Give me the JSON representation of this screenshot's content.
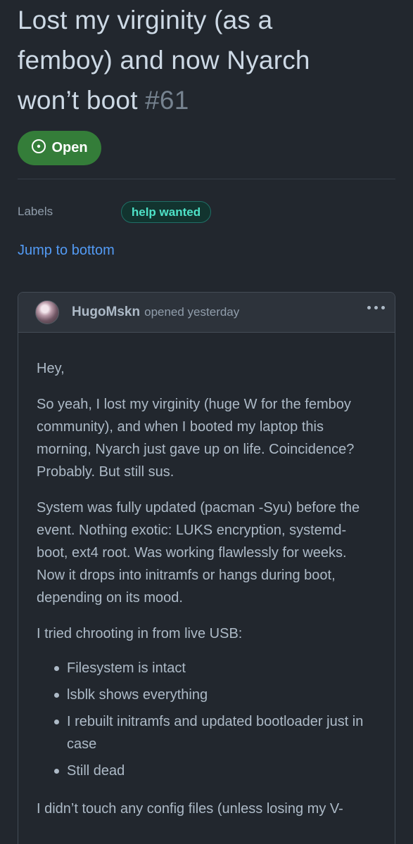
{
  "issue": {
    "title_line1": "Lost my virginity (as a",
    "title_line2": "femboy) and now Nyarch",
    "title_line3": "won’t boot",
    "number": "#61",
    "state": "Open",
    "state_icon": "issue-opened-icon",
    "colors": {
      "open": "#347d39",
      "link": "#539bf5",
      "label_text": "#4ee2c7"
    }
  },
  "sidebar": {
    "labels_heading": "Labels",
    "labels": [
      "help wanted"
    ]
  },
  "nav": {
    "jump_to_bottom": "Jump to bottom"
  },
  "comment": {
    "author": "HugoMskn",
    "meta": "opened yesterday",
    "menu_icon": "kebab-horizontal-icon",
    "paragraphs": [
      "Hey,",
      "So yeah, I lost my virginity (huge W for the femboy community), and when I booted my laptop this morning, Nyarch just gave up on life. Coincidence? Probably. But still sus.",
      "System was fully updated (pacman -Syu) before the event. Nothing exotic: LUKS encryption, systemd-boot, ext4 root. Was working flawlessly for weeks. Now it drops into initramfs or hangs during boot, depending on its mood.",
      "I tried chrooting in from live USB:"
    ],
    "list": [
      "Filesystem is intact",
      "lsblk shows everything",
      "I rebuilt initramfs and updated bootloader just in case",
      "Still dead"
    ],
    "closing": "I didn’t touch any config files (unless losing my V-"
  }
}
